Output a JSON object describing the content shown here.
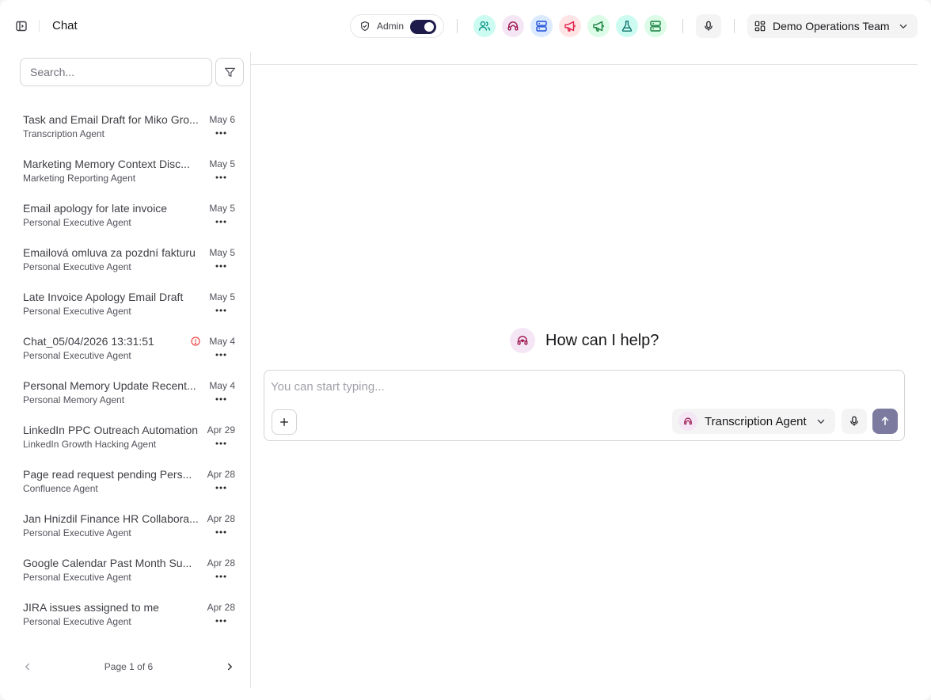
{
  "header": {
    "title": "Chat",
    "admin_label": "Admin",
    "admin_toggle_on": true,
    "team_label": "Demo Operations Team",
    "agent_shortcuts": [
      {
        "icon": "users-icon",
        "color": "#0d9488",
        "bg": "#ccfbf1"
      },
      {
        "icon": "headset-icon",
        "color": "#9d174d",
        "bg": "#f5e6f5"
      },
      {
        "icon": "server-icon",
        "color": "#1d4ed8",
        "bg": "#dbeafe"
      },
      {
        "icon": "megaphone-icon",
        "color": "#e11d48",
        "bg": "#ffe4e6"
      },
      {
        "icon": "megaphone-icon",
        "color": "#15803d",
        "bg": "#dcfce7"
      },
      {
        "icon": "flask-icon",
        "color": "#0f766e",
        "bg": "#ccfbf1"
      },
      {
        "icon": "server-icon",
        "color": "#15803d",
        "bg": "#dcfce7"
      }
    ]
  },
  "sidebar": {
    "search_placeholder": "Search...",
    "chats": [
      {
        "title": "Task and Email Draft for Miko Gro...",
        "agent": "Transcription Agent",
        "date": "May 6",
        "error": false
      },
      {
        "title": "Marketing Memory Context Disc...",
        "agent": "Marketing Reporting Agent",
        "date": "May 5",
        "error": false
      },
      {
        "title": "Email apology for late invoice",
        "agent": "Personal Executive Agent",
        "date": "May 5",
        "error": false
      },
      {
        "title": "Emailová omluva za pozdní fakturu",
        "agent": "Personal Executive Agent",
        "date": "May 5",
        "error": false
      },
      {
        "title": "Late Invoice Apology Email Draft",
        "agent": "Personal Executive Agent",
        "date": "May 5",
        "error": false
      },
      {
        "title": "Chat_05/04/2026 13:31:51",
        "agent": "Personal Executive Agent",
        "date": "May 4",
        "error": true
      },
      {
        "title": "Personal Memory Update Recent...",
        "agent": "Personal Memory Agent",
        "date": "May 4",
        "error": false
      },
      {
        "title": "LinkedIn PPC Outreach Automation",
        "agent": "LinkedIn Growth Hacking Agent",
        "date": "Apr 29",
        "error": false
      },
      {
        "title": "Page read request pending Pers...",
        "agent": "Confluence Agent",
        "date": "Apr 28",
        "error": false
      },
      {
        "title": "Jan Hnizdil Finance HR Collabora...",
        "agent": "Personal Executive Agent",
        "date": "Apr 28",
        "error": false
      },
      {
        "title": "Google Calendar Past Month Su...",
        "agent": "Personal Executive Agent",
        "date": "Apr 28",
        "error": false
      },
      {
        "title": "JIRA issues assigned to me",
        "agent": "Personal Executive Agent",
        "date": "Apr 28",
        "error": false
      }
    ],
    "pagination": {
      "label": "Page 1 of 6"
    }
  },
  "main": {
    "greeting": "How can I help?",
    "composer": {
      "placeholder": "You can start typing...",
      "selected_agent": "Transcription Agent"
    }
  }
}
